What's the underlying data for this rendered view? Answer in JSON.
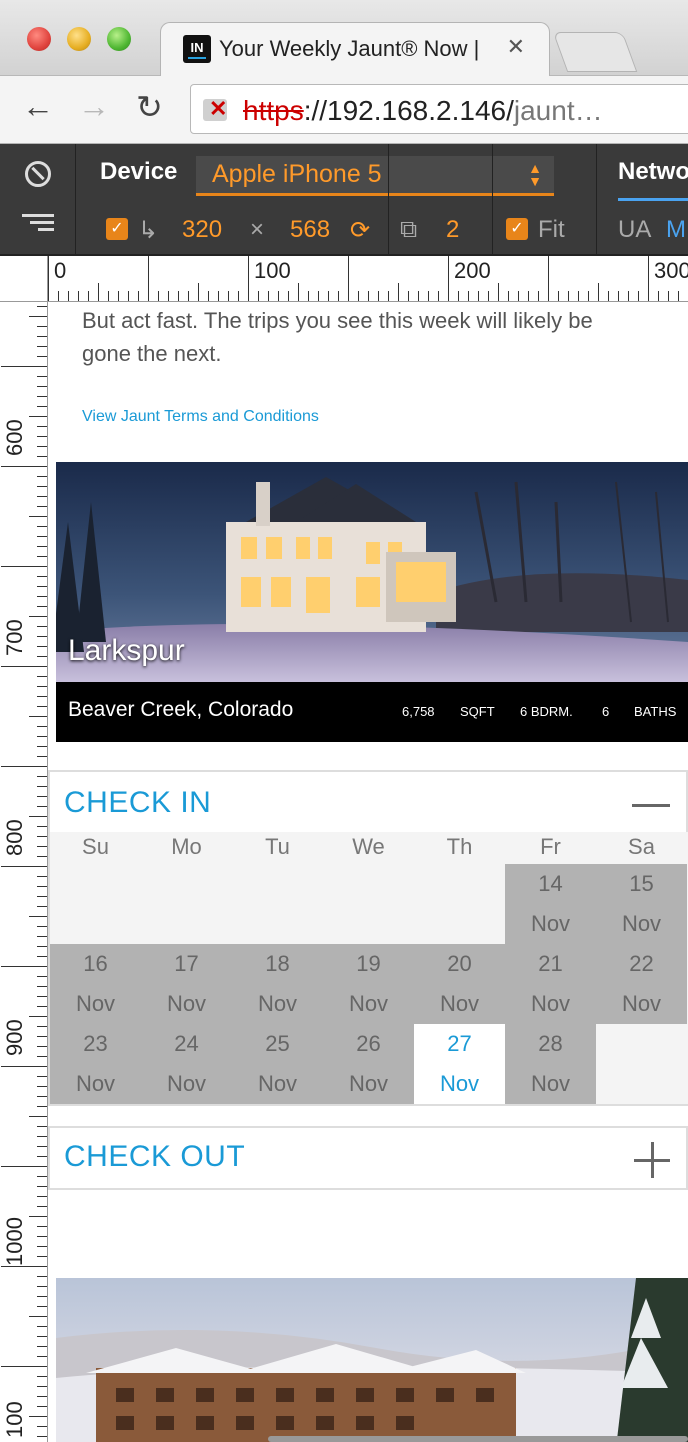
{
  "browser": {
    "tab_favicon": "IN",
    "tab_title": "Your Weekly Jaunt® Now |",
    "tab_close": "✕",
    "url_scheme": "https",
    "url_rest": "://192.168.2.146/",
    "url_tail": "jaunt…"
  },
  "devtools": {
    "device_label": "Device",
    "device_value": "Apple iPhone 5",
    "width": "320",
    "times": "×",
    "height": "568",
    "scale": "2",
    "fit_label": "Fit",
    "network_label": "Network",
    "ua_label": "UA",
    "ua_value": "M"
  },
  "ruler": {
    "top_labels": [
      "0",
      "100",
      "200",
      "300"
    ],
    "left_labels": [
      "600",
      "700",
      "800",
      "900",
      "1000",
      "100"
    ]
  },
  "page": {
    "intro_text": "But act fast. The trips you see this week will likely be gone the next.",
    "terms_link": "View Jaunt Terms and Conditions",
    "hero": {
      "name": "Larkspur",
      "location": "Beaver Creek, Colorado",
      "sqft_value": "6,758",
      "sqft_label": "SQFT",
      "bedrooms": "6 BDRM.",
      "baths_value": "6",
      "baths_label": "BATHS"
    },
    "checkin": {
      "title": "CHECK IN",
      "days_of_week": [
        "Su",
        "Mo",
        "Tu",
        "We",
        "Th",
        "Fr",
        "Sa"
      ],
      "month": "Nov",
      "selected_day": "27"
    },
    "checkout": {
      "title": "CHECK OUT"
    }
  },
  "colors": {
    "accent": "#1a9ad6",
    "devtools_orange": "#ff9a2a",
    "calendar_cell": "#b2b2b2"
  }
}
